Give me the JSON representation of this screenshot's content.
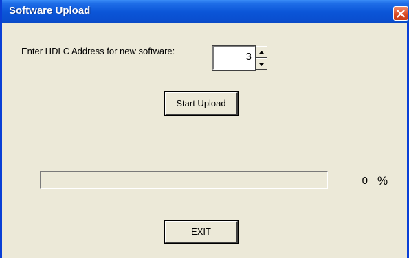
{
  "window": {
    "title": "Software Upload",
    "close_icon": "close-icon"
  },
  "form": {
    "hdlc_label": "Enter HDLC Address for new software:",
    "hdlc_value": "3",
    "spin_up_icon": "arrow-up-icon",
    "spin_down_icon": "arrow-down-icon"
  },
  "actions": {
    "start_label": "Start Upload",
    "exit_label": "EXIT"
  },
  "progress": {
    "value_percent": 0,
    "percent_text": "0",
    "percent_sign": "%"
  },
  "colors": {
    "titlebar": "#0b56d8",
    "window_bg": "#ece9d8",
    "close_button": "#d94a22"
  }
}
